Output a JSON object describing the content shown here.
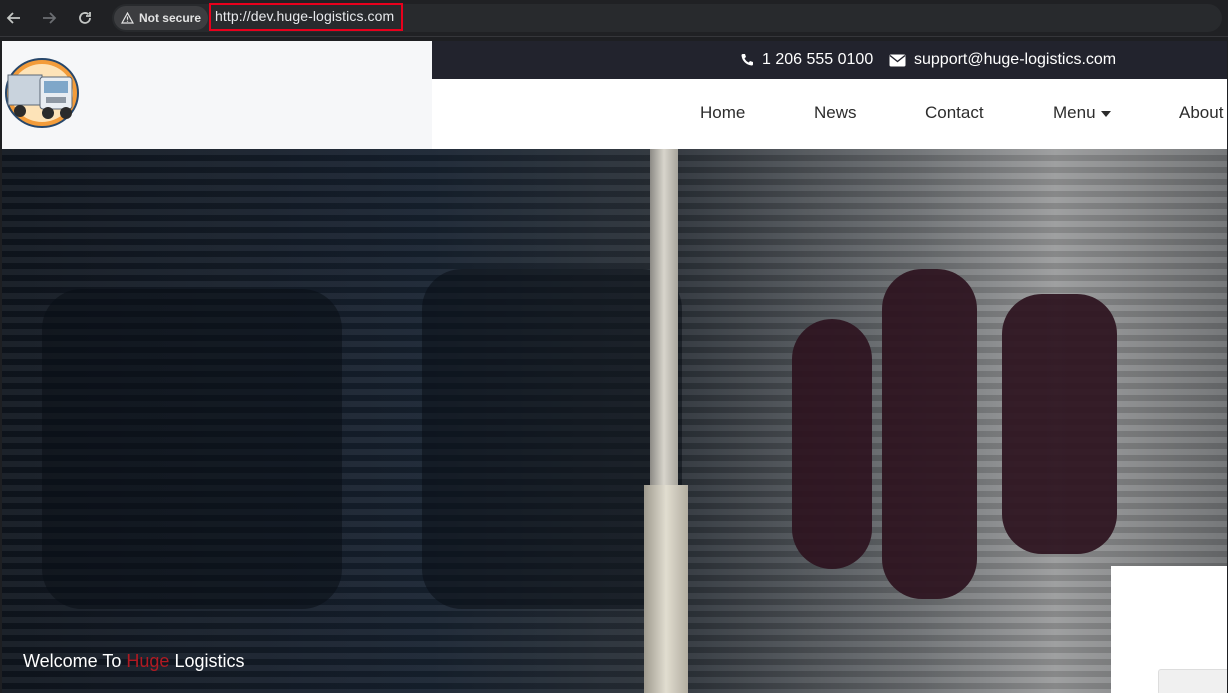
{
  "browser": {
    "back_icon": "arrow-left-icon",
    "forward_icon": "arrow-right-icon",
    "reload_icon": "reload-icon",
    "security_label": "Not secure",
    "warning_icon": "warning-triangle-icon",
    "url": "http://dev.huge-logistics.com",
    "highlight_color": "#e8001c"
  },
  "site": {
    "topbar": {
      "phone": "1 206 555 0100",
      "phone_icon": "phone-icon",
      "email": "support@huge-logistics.com",
      "email_icon": "envelope-icon",
      "background": "#22232d"
    },
    "nav": {
      "home": "Home",
      "news": "News",
      "contact": "Contact",
      "menu": "Menu",
      "about": "About"
    },
    "logo_icon": "truck-logo-icon",
    "hero": {
      "welcome": "Welcome To",
      "brand_accent": "Huge",
      "brand_rest": "Logistics",
      "accent_color": "#b01a22"
    }
  }
}
